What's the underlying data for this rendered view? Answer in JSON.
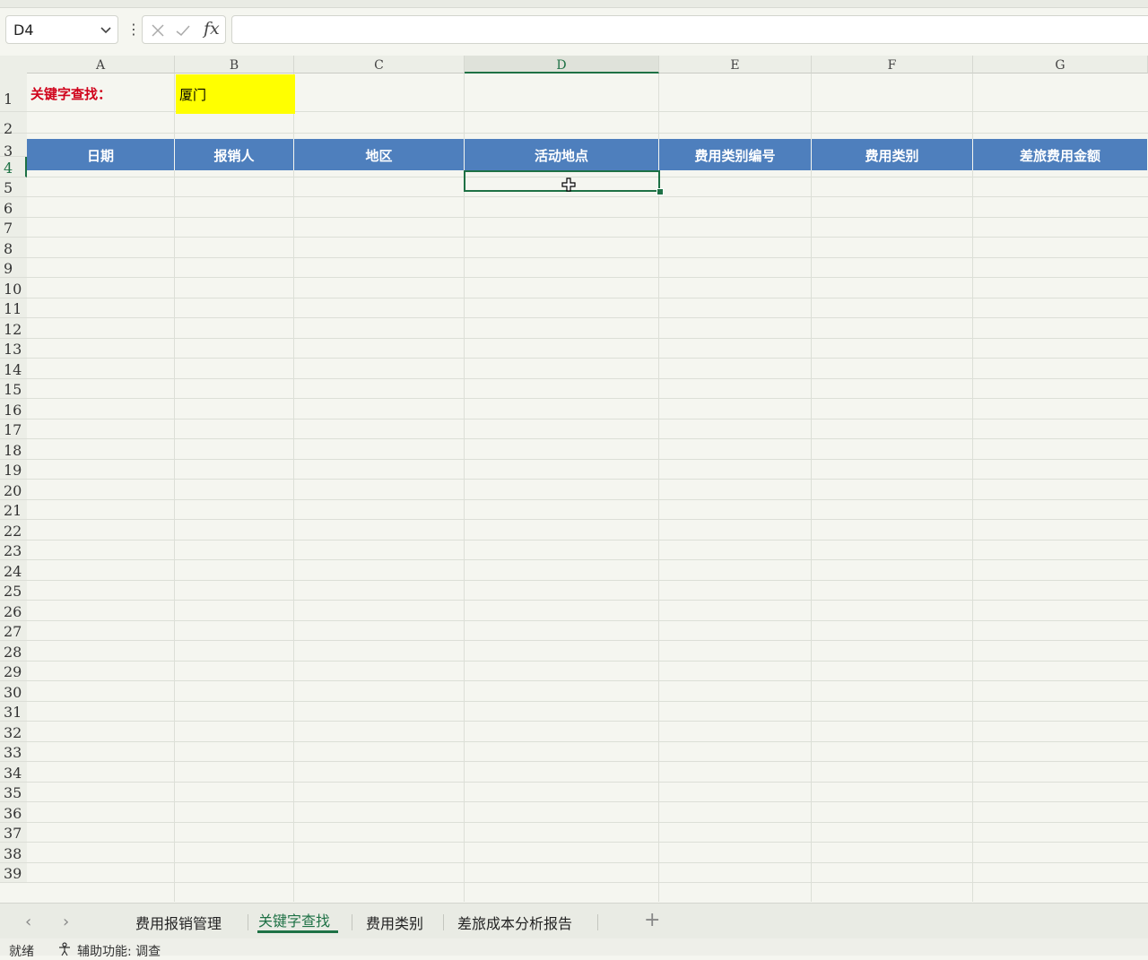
{
  "formula_bar": {
    "name_box": "D4",
    "separator": "⋮",
    "fx_label": "fx",
    "formula_value": ""
  },
  "columns": [
    "A",
    "B",
    "C",
    "D",
    "E",
    "F",
    "G"
  ],
  "rows": [
    "1",
    "2",
    "3",
    "4",
    "5",
    "6",
    "7",
    "8",
    "9",
    "10",
    "11",
    "12",
    "13",
    "14",
    "15",
    "16",
    "17",
    "18",
    "19",
    "20",
    "21",
    "22",
    "23",
    "24",
    "25",
    "26",
    "27",
    "28",
    "29",
    "30",
    "31",
    "32",
    "33",
    "34",
    "35",
    "36",
    "37",
    "38",
    "39"
  ],
  "cells": {
    "a1_label": "关键字查找：",
    "b1_value": "厦门"
  },
  "table_headers": [
    "日期",
    "报销人",
    "地区",
    "活动地点",
    "费用类别编号",
    "费用类别",
    "差旅费用金额"
  ],
  "sheet_tabs": [
    "费用报销管理",
    "关键字查找",
    "费用类别",
    "差旅成本分析报告"
  ],
  "active_tab": "关键字查找",
  "status": {
    "ready": "就绪",
    "accessibility": "辅助功能: 调查"
  },
  "colors": {
    "header_fill": "#4e7fbd",
    "keyword_fill": "#ffff00",
    "label_red": "#d0021b",
    "accent_green": "#1e7145"
  }
}
